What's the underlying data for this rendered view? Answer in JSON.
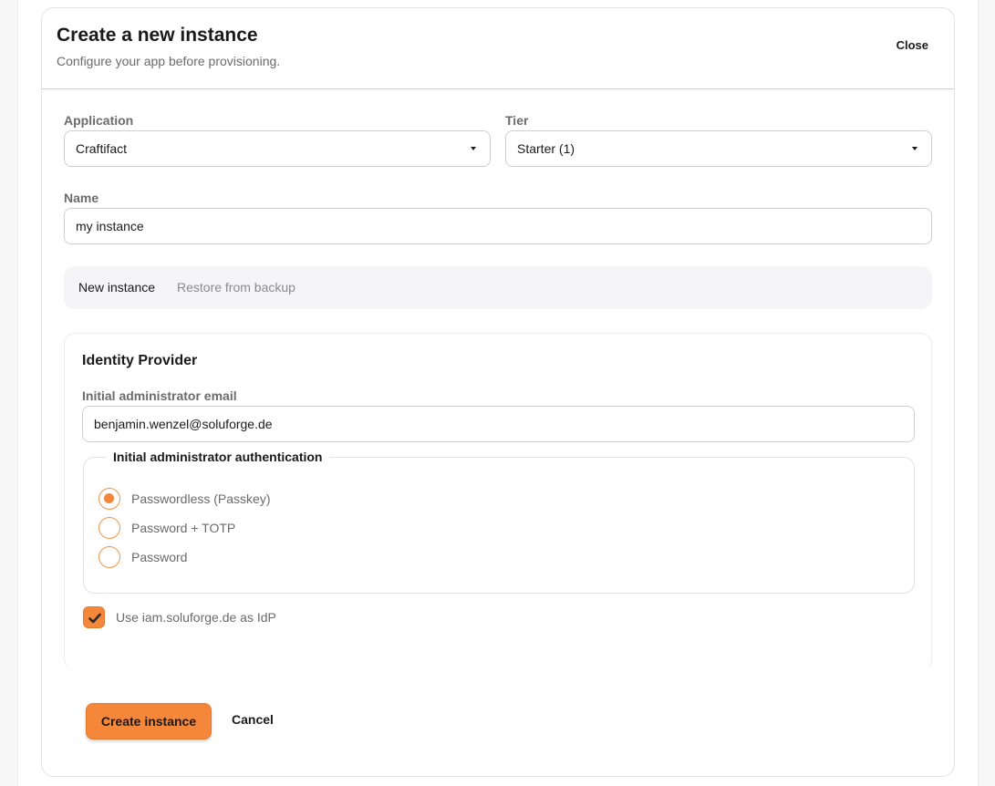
{
  "dialog": {
    "title": "Create a new instance",
    "subtitle": "Configure your app before provisioning.",
    "close_label": "Close"
  },
  "form": {
    "application": {
      "label": "Application",
      "value": "Craftifact"
    },
    "tier": {
      "label": "Tier",
      "value": "Starter (1)"
    },
    "name": {
      "label": "Name",
      "value": "my instance"
    }
  },
  "tabs": [
    {
      "label": "New instance",
      "active": true
    },
    {
      "label": "Restore from backup",
      "active": false
    }
  ],
  "idp": {
    "title": "Identity Provider",
    "email_label": "Initial administrator email",
    "email_value": "benjamin.wenzel@soluforge.de",
    "auth_legend": "Initial administrator authentication",
    "auth_options": [
      {
        "label": "Passwordless (Passkey)",
        "checked": true
      },
      {
        "label": "Password + TOTP",
        "checked": false
      },
      {
        "label": "Password",
        "checked": false
      }
    ],
    "use_idp_label": "Use iam.soluforge.de as IdP",
    "use_idp_checked": true
  },
  "actions": {
    "create_label": "Create instance",
    "cancel_label": "Cancel"
  },
  "colors": {
    "accent": "#f5873a",
    "border": "#cfcfd3",
    "muted_text": "#6b6b6b"
  }
}
